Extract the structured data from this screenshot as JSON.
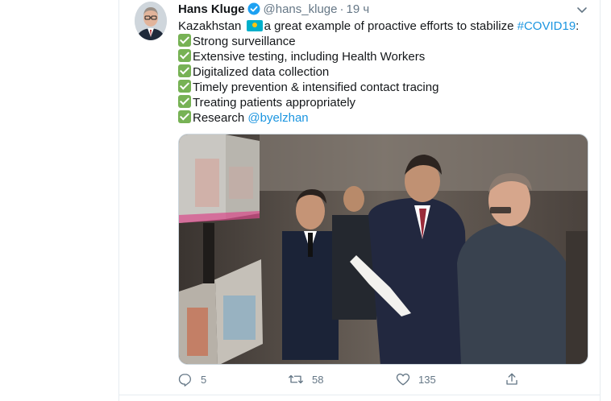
{
  "tweet": {
    "author_name": "Hans Kluge",
    "author_handle": "@hans_kluge",
    "separator": "·",
    "time": "19 ч",
    "lines": {
      "intro_before_flag": "Kazakhstan ",
      "intro_after_flag": "a great example of proactive efforts to stabilize ",
      "hashtag": "#COVID19",
      "colon": ":",
      "item1": "Strong surveillance",
      "item2": "Extensive testing, including Health Workers",
      "item3": "Digitalized data collection",
      "item4": "Timely prevention & intensified contact tracing",
      "item5": "Treating patients appropriately",
      "item6": "Research ",
      "mention": "@byelzhan"
    },
    "counts": {
      "replies": "5",
      "retweets": "58",
      "likes": "135"
    },
    "colors": {
      "link": "#1b95e0",
      "secondary_text": "#657786",
      "verified": "#1da1f2",
      "check_emoji": "#77b255"
    },
    "icons": [
      "verified-badge-icon",
      "caret-down-icon",
      "reply-icon",
      "retweet-icon",
      "like-icon",
      "share-icon",
      "check-mark-emoji-icon",
      "kazakhstan-flag-icon"
    ]
  }
}
